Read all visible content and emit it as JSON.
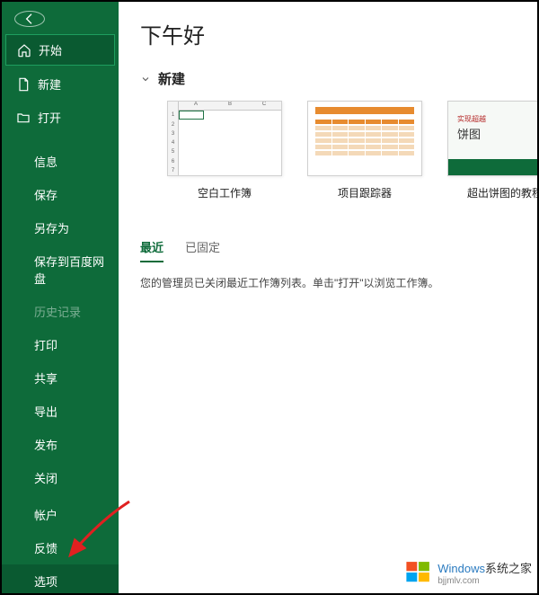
{
  "greeting": "下午好",
  "sidebar": {
    "back_tooltip": "返回",
    "primary": [
      {
        "label": "开始",
        "icon": "home"
      },
      {
        "label": "新建",
        "icon": "file"
      },
      {
        "label": "打开",
        "icon": "folder"
      }
    ],
    "files": [
      {
        "label": "信息"
      },
      {
        "label": "保存"
      },
      {
        "label": "另存为"
      },
      {
        "label": "保存到百度网盘"
      },
      {
        "label": "历史记录",
        "disabled": true
      },
      {
        "label": "打印"
      },
      {
        "label": "共享"
      },
      {
        "label": "导出"
      },
      {
        "label": "发布"
      },
      {
        "label": "关闭"
      }
    ],
    "bottom": [
      {
        "label": "帐户"
      },
      {
        "label": "反馈"
      },
      {
        "label": "选项",
        "highlight": true
      }
    ]
  },
  "new_section": {
    "label": "新建",
    "templates": [
      {
        "name": "空白工作簿",
        "kind": "blank"
      },
      {
        "name": "项目跟踪器",
        "kind": "tracker"
      },
      {
        "name": "超出饼图的教程",
        "kind": "pie",
        "pie_text1": "实现超越",
        "pie_text2": "饼图"
      }
    ]
  },
  "recent": {
    "tabs": [
      {
        "label": "最近",
        "active": true
      },
      {
        "label": "已固定"
      }
    ],
    "message": "您的管理员已关闭最近工作簿列表。单击\"打开\"以浏览工作簿。"
  },
  "watermark": {
    "line1a": "Windows",
    "line1b": "系统之家",
    "line2": "bjjmlv.com"
  }
}
